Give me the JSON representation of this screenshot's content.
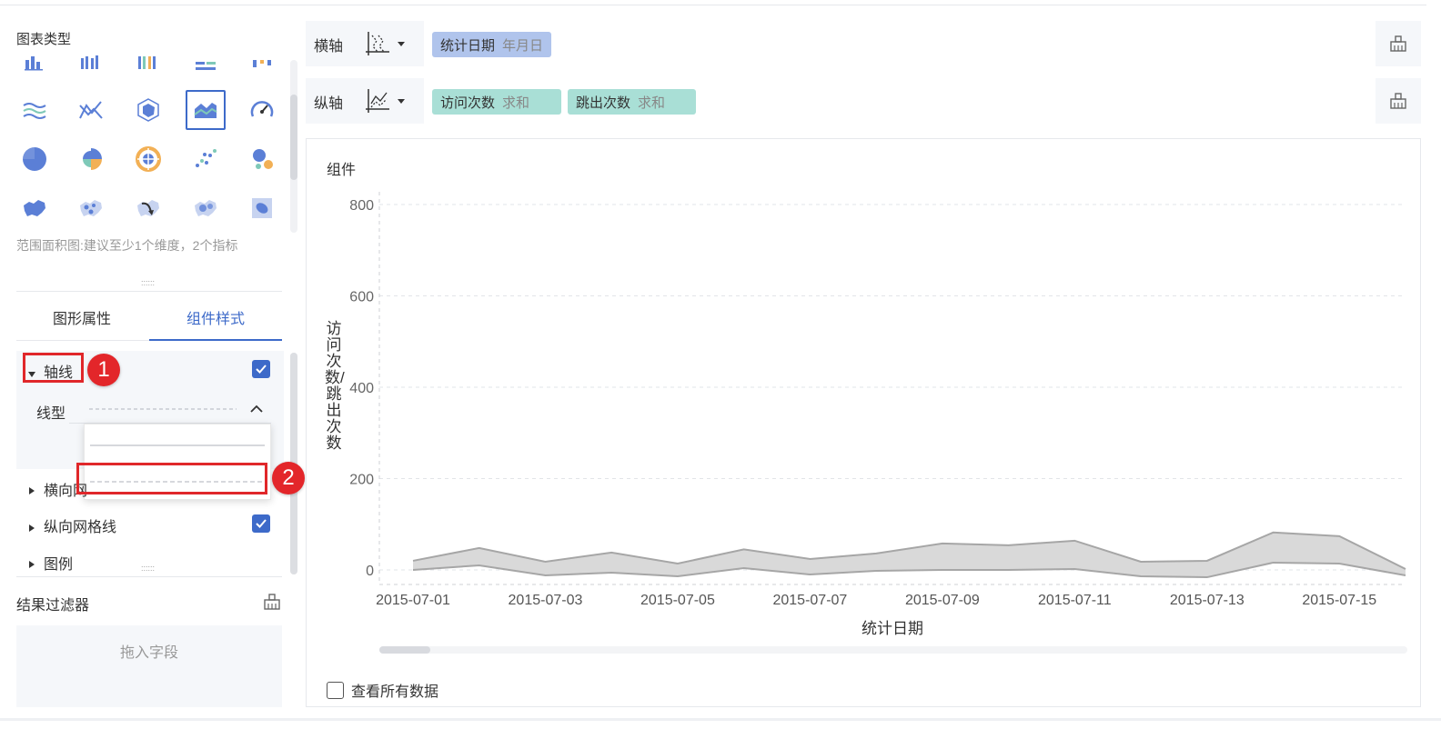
{
  "chart_types": {
    "title": "图表类型",
    "hint": "范围面积图:建议至少1个维度，2个指标"
  },
  "tabs": [
    {
      "label": "图形属性"
    },
    {
      "label": "组件样式"
    }
  ],
  "properties": {
    "axis_line": {
      "label": "轴线",
      "checked": true
    },
    "line_type": {
      "label": "线型"
    },
    "horizontal_grid": {
      "label": "横向网"
    },
    "vertical_grid": {
      "label": "纵向网格线",
      "checked": true
    },
    "legend": {
      "label": "图例"
    }
  },
  "markers": {
    "one": "1",
    "two": "2"
  },
  "filter": {
    "title": "结果过滤器",
    "drop_text": "拖入字段"
  },
  "x_axis_bar": {
    "label": "横轴",
    "fields": [
      {
        "name": "统计日期",
        "agg": "年月日"
      }
    ]
  },
  "y_axis_bar": {
    "label": "纵轴",
    "fields": [
      {
        "name": "访问次数",
        "agg": "求和"
      },
      {
        "name": "跳出次数",
        "agg": "求和"
      }
    ]
  },
  "component": {
    "title": "组件",
    "view_all": "查看所有数据"
  },
  "colors": {
    "accent": "#3d6ac9",
    "area_fill": "#d9d9d9",
    "area_stroke": "#a6a6a6",
    "marker_red": "#e3262a"
  },
  "chart_data": {
    "type": "area",
    "subtype": "range-area",
    "xlabel": "统计日期",
    "ylabel": "访问次数/跳出次数",
    "ylim": [
      0,
      800
    ],
    "yticks": [
      0,
      200,
      400,
      600,
      800
    ],
    "xticks": [
      "2015-07-01",
      "2015-07-03",
      "2015-07-05",
      "2015-07-07",
      "2015-07-09",
      "2015-07-11",
      "2015-07-13",
      "2015-07-15"
    ],
    "x": [
      "2015-07-01",
      "2015-07-02",
      "2015-07-03",
      "2015-07-04",
      "2015-07-05",
      "2015-07-06",
      "2015-07-07",
      "2015-07-08",
      "2015-07-09",
      "2015-07-10",
      "2015-07-11",
      "2015-07-12",
      "2015-07-13",
      "2015-07-14",
      "2015-07-15",
      "2015-07-16"
    ],
    "series": [
      {
        "name": "访问次数",
        "values": [
          20,
          48,
          18,
          38,
          14,
          45,
          24,
          36,
          58,
          54,
          64,
          18,
          20,
          82,
          74,
          2
        ]
      },
      {
        "name": "跳出次数",
        "values": [
          0,
          10,
          -12,
          -6,
          -14,
          4,
          -10,
          -2,
          0,
          0,
          2,
          -14,
          -16,
          16,
          14,
          -12
        ]
      }
    ],
    "grid": {
      "horizontal": true,
      "vertical": false,
      "style": "dashed"
    }
  }
}
